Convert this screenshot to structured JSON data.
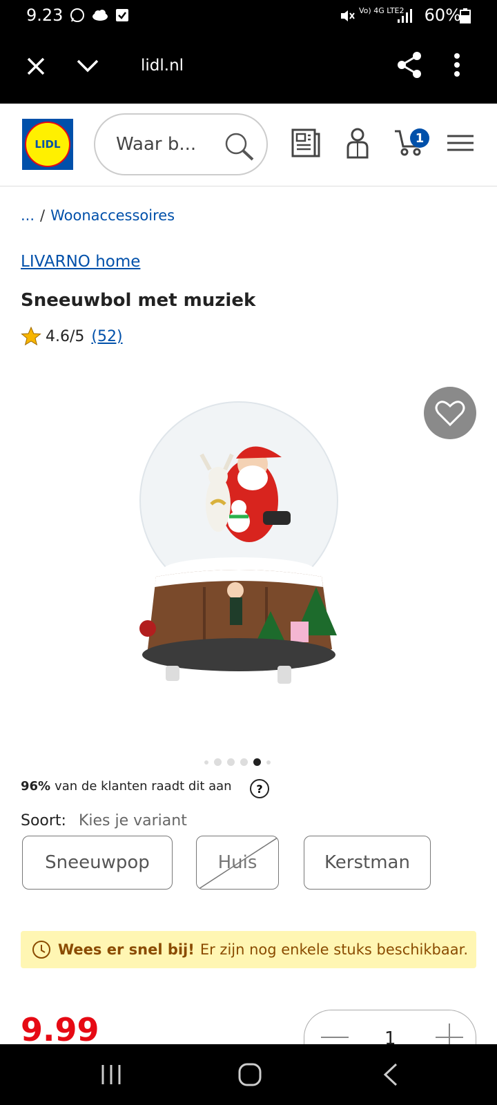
{
  "status_bar": {
    "time": "9.23",
    "battery": "60%",
    "network": "Vo) 4G LTE2"
  },
  "browser": {
    "url": "lidl.nl"
  },
  "header": {
    "logo_text": "LIDL",
    "search_placeholder": "Waar b...",
    "cart_count": "1"
  },
  "breadcrumb": {
    "ellipsis": "...",
    "separator": "/",
    "category": "Woonaccessoires"
  },
  "product": {
    "brand": "LIVARNO home",
    "title": "Sneeuwbol met muziek",
    "rating": "4.6/5",
    "review_count": "(52)",
    "image_dots": 6,
    "active_dot": 5,
    "recommend_pct": "96%",
    "recommend_text": "van de klanten raadt dit aan",
    "help": "?",
    "variant_label": "Soort:",
    "variant_hint": "Kies je variant",
    "variants": [
      {
        "label": "Sneeuwpop",
        "available": true
      },
      {
        "label": "Huis",
        "available": false
      },
      {
        "label": "Kerstman",
        "available": true
      }
    ],
    "notice_strong": "Wees er snel bij!",
    "notice_text": "Er zijn nog enkele stuks beschikbaar.",
    "price": "9.99",
    "quantity": "1"
  },
  "colors": {
    "brand_blue": "#0050aa",
    "price_red": "#e60a14",
    "notice_bg": "#fff6b3"
  }
}
